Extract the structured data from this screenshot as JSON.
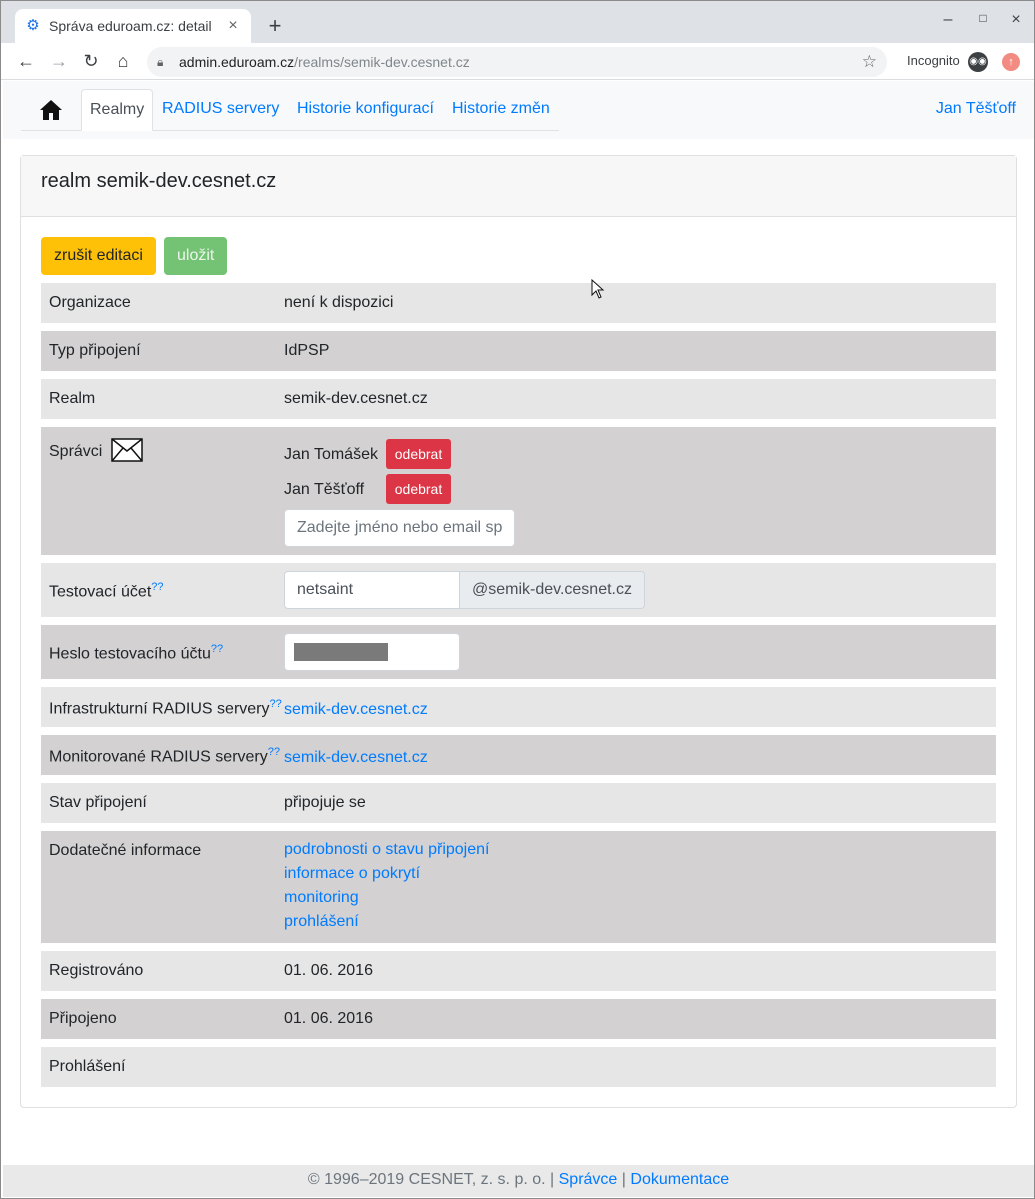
{
  "browser": {
    "tab_title": "Správa eduroam.cz: detail",
    "tab_close": "×",
    "new_tab": "+",
    "url_host": "admin.eduroam.cz",
    "url_path": "/realms/semik-dev.cesnet.cz",
    "incognito_label": "Incognito",
    "win_minimize": "–",
    "win_maximize": "□",
    "win_close": "×"
  },
  "nav": {
    "tabs": [
      {
        "label": "Realmy"
      },
      {
        "label": "RADIUS servery"
      },
      {
        "label": "Historie konfigurací"
      },
      {
        "label": "Historie změn"
      }
    ],
    "user": "Jan Těšťoff"
  },
  "card": {
    "title": "realm semik-dev.cesnet.cz",
    "cancel_button": "zrušit editaci",
    "save_button": "uložit"
  },
  "rows": {
    "organizace": {
      "label": "Organizace",
      "value": "není k dispozici"
    },
    "typ": {
      "label": "Typ připojení",
      "value": "IdPSP"
    },
    "realm": {
      "label": "Realm",
      "value": "semik-dev.cesnet.cz"
    },
    "spravci": {
      "label": "Správci",
      "admins": [
        {
          "name": "Jan Tomášek",
          "action": "odebrat"
        },
        {
          "name": "Jan Těšťoff",
          "action": "odebrat"
        }
      ],
      "search_placeholder": "Zadejte jméno nebo email sp"
    },
    "test_account": {
      "label": "Testovací účet",
      "help": "??",
      "value": "netsaint",
      "suffix": "@semik-dev.cesnet.cz"
    },
    "test_password": {
      "label": "Heslo testovacího účtu",
      "help": "??"
    },
    "infra_radius": {
      "label": "Infrastrukturní RADIUS servery",
      "help": "??",
      "link": "semik-dev.cesnet.cz"
    },
    "mon_radius": {
      "label": "Monitorované RADIUS servery",
      "help": "??",
      "link": "semik-dev.cesnet.cz"
    },
    "stav": {
      "label": "Stav připojení",
      "value": "připojuje se"
    },
    "dodatecne": {
      "label": "Dodatečné informace",
      "links": [
        "podrobnosti o stavu připojení",
        "informace o pokrytí",
        "monitoring",
        "prohlášení"
      ]
    },
    "registrovano": {
      "label": "Registrováno",
      "value": "01. 06. 2016"
    },
    "pripojeno": {
      "label": "Připojeno",
      "value": "01. 06. 2016"
    },
    "prohlaseni": {
      "label": "Prohlášení",
      "value": ""
    }
  },
  "footer": {
    "copyright": "© 1996–2019 CESNET, z. s. p. o. |",
    "sep": "|",
    "link_spravce": "Správce",
    "link_docs": "Dokumentace"
  },
  "colors": {
    "link": "#007bff",
    "cancel": "#ffc107",
    "save": "#5cb85c",
    "remove": "#dc3545"
  }
}
